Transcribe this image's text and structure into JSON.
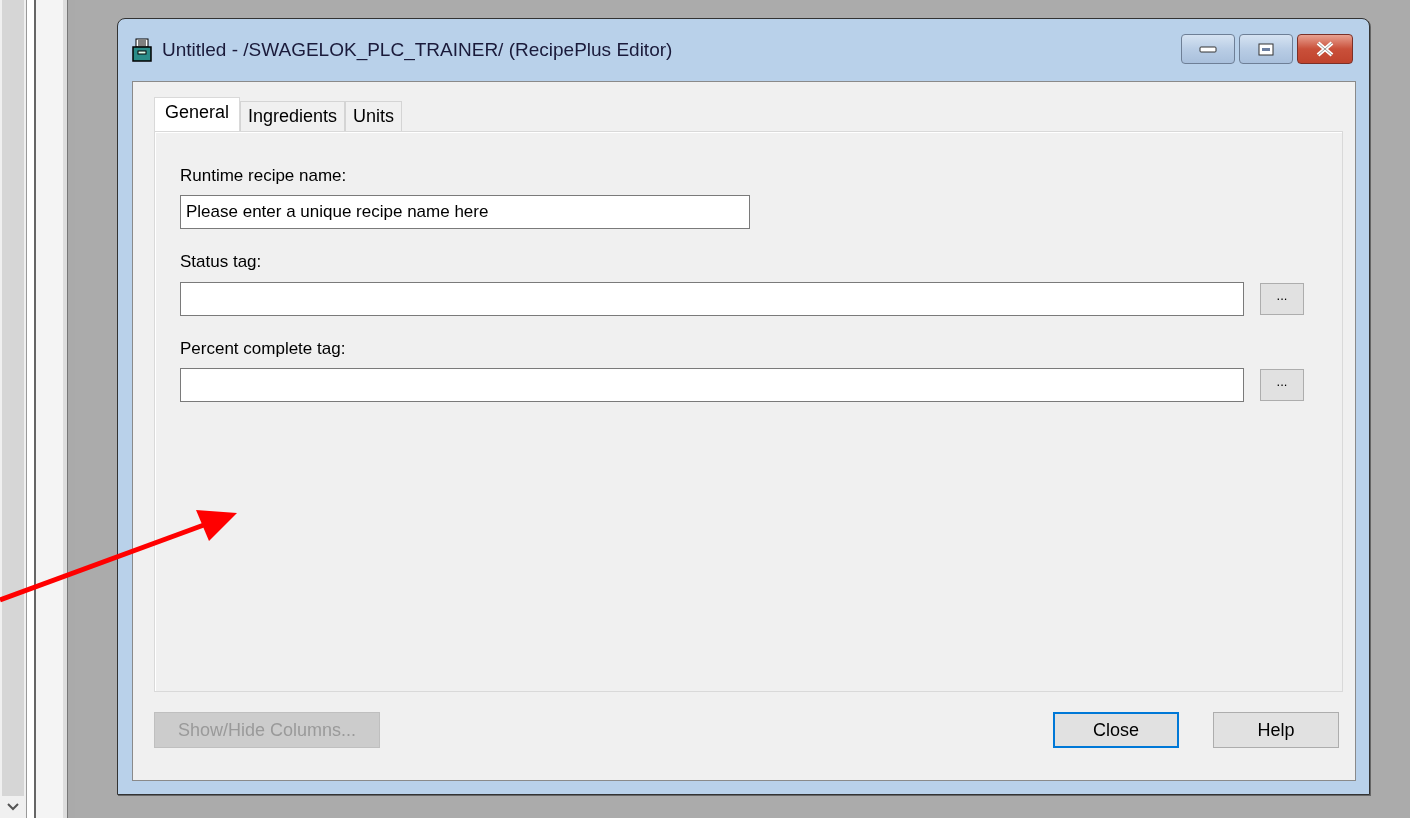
{
  "window": {
    "title": "Untitled - /SWAGELOK_PLC_TRAINER/ (RecipePlus Editor)"
  },
  "tabs": [
    {
      "label": "General",
      "selected": true
    },
    {
      "label": "Ingredients",
      "selected": false
    },
    {
      "label": "Units",
      "selected": false
    }
  ],
  "fields": [
    {
      "label": "Runtime recipe name:",
      "value": "Please enter a unique recipe name here",
      "kind": "short"
    },
    {
      "label": "Status tag:",
      "kind": "browse",
      "browse_label": "..."
    },
    {
      "label": "Percent complete tag:",
      "kind": "browse",
      "browse_label": "..."
    }
  ],
  "left_buttons": [
    {
      "label": "Show/Hide Columns...",
      "disabled": true,
      "default": false
    }
  ],
  "right_buttons": [
    {
      "label": "Close",
      "disabled": false,
      "default": true
    },
    {
      "label": "Help",
      "disabled": false,
      "default": false
    }
  ]
}
